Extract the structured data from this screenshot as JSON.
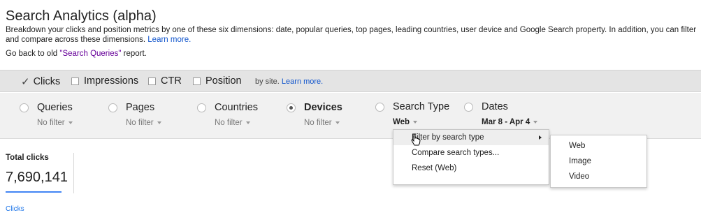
{
  "page": {
    "title": "Search Analytics (alpha)",
    "description": "Breakdown your clicks and position metrics by one of these six dimensions: date, popular queries, top pages, leading countries, user device and Google Search property. In addition, you can filter and compare across these dimensions.",
    "learn_more": "Learn more.",
    "goback_prefix": "Go back to old ",
    "goback_link": "\"Search Queries\"",
    "goback_suffix": " report."
  },
  "metrics": {
    "items": [
      {
        "label": "Clicks",
        "checked": true
      },
      {
        "label": "Impressions",
        "checked": false
      },
      {
        "label": "CTR",
        "checked": false
      },
      {
        "label": "Position",
        "checked": false
      }
    ],
    "note": "by site.",
    "note_link": "Learn more."
  },
  "dimensions": [
    {
      "label": "Queries",
      "filter": "No filter",
      "selected": false
    },
    {
      "label": "Pages",
      "filter": "No filter",
      "selected": false
    },
    {
      "label": "Countries",
      "filter": "No filter",
      "selected": false
    },
    {
      "label": "Devices",
      "filter": "No filter",
      "selected": true
    },
    {
      "label": "Search Type",
      "filter": "Web",
      "selected": false
    },
    {
      "label": "Dates",
      "filter": "Mar 8 - Apr 4",
      "selected": false
    }
  ],
  "menu": {
    "items": [
      "Filter by search type",
      "Compare search types...",
      "Reset (Web)"
    ]
  },
  "submenu": {
    "items": [
      "Web",
      "Image",
      "Video"
    ]
  },
  "totals": {
    "label": "Total clicks",
    "value": "7,690,141",
    "chart_link": "Clicks"
  },
  "colors": {
    "link": "#1155cc",
    "visited_link": "#660099",
    "accent": "#4285f4"
  }
}
